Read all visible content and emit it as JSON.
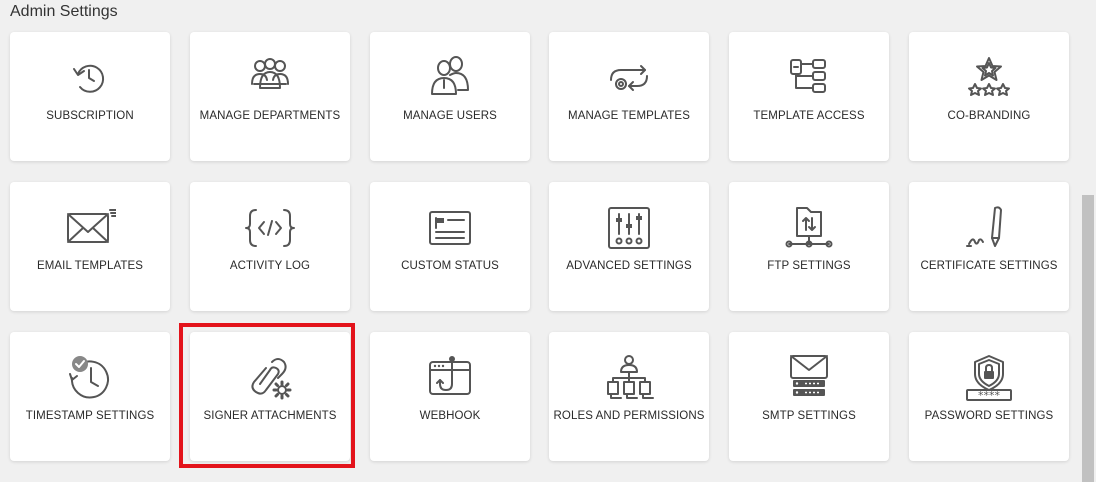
{
  "page_title": "Admin Settings",
  "tiles": [
    {
      "label": "SUBSCRIPTION",
      "icon": "subscription-icon"
    },
    {
      "label": "MANAGE DEPARTMENTS",
      "icon": "departments-icon"
    },
    {
      "label": "MANAGE USERS",
      "icon": "users-icon"
    },
    {
      "label": "MANAGE TEMPLATES",
      "icon": "templates-icon"
    },
    {
      "label": "TEMPLATE ACCESS",
      "icon": "template-access-icon"
    },
    {
      "label": "CO-BRANDING",
      "icon": "co-branding-icon"
    },
    {
      "label": "EMAIL TEMPLATES",
      "icon": "email-templates-icon"
    },
    {
      "label": "ACTIVITY LOG",
      "icon": "activity-log-icon"
    },
    {
      "label": "CUSTOM STATUS",
      "icon": "custom-status-icon"
    },
    {
      "label": "ADVANCED SETTINGS",
      "icon": "advanced-settings-icon"
    },
    {
      "label": "FTP SETTINGS",
      "icon": "ftp-settings-icon"
    },
    {
      "label": "CERTIFICATE SETTINGS",
      "icon": "certificate-settings-icon"
    },
    {
      "label": "TIMESTAMP SETTINGS",
      "icon": "timestamp-settings-icon"
    },
    {
      "label": "SIGNER ATTACHMENTS",
      "icon": "signer-attachments-icon"
    },
    {
      "label": "WEBHOOK",
      "icon": "webhook-icon"
    },
    {
      "label": "ROLES AND PERMISSIONS",
      "icon": "roles-permissions-icon"
    },
    {
      "label": "SMTP SETTINGS",
      "icon": "smtp-settings-icon"
    },
    {
      "label": "PASSWORD SETTINGS",
      "icon": "password-settings-icon"
    }
  ],
  "highlight_color": "#e3131b",
  "icon_color": "#555555"
}
